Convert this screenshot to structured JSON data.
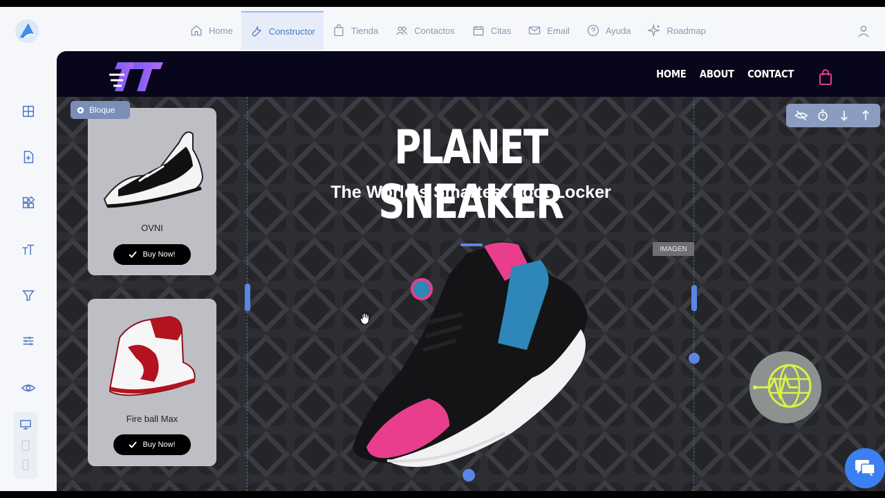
{
  "topnav": {
    "items": [
      {
        "label": "Home",
        "icon": "home-icon"
      },
      {
        "label": "Constructor",
        "icon": "wrench-icon",
        "active": true
      },
      {
        "label": "Tienda",
        "icon": "bag-icon"
      },
      {
        "label": "Contactos",
        "icon": "users-icon"
      },
      {
        "label": "Citas",
        "icon": "calendar-icon"
      },
      {
        "label": "Email",
        "icon": "mail-icon"
      },
      {
        "label": "Ayuda",
        "icon": "help-icon"
      },
      {
        "label": "Roadmap",
        "icon": "sparkle-icon"
      }
    ]
  },
  "sidebar": {
    "icons": [
      "layers-icon",
      "add-page-icon",
      "widgets-icon",
      "text-icon",
      "filter-icon",
      "sliders-icon",
      "eye-icon"
    ],
    "devices": [
      "desktop-icon",
      "tablet-icon",
      "mobile-icon"
    ]
  },
  "site": {
    "nav": [
      "HOME",
      "ABOUT",
      "CONTACT"
    ],
    "title": "PLANET SNEAKER",
    "subtitle": "The World's Smartest Foot Locker",
    "products": [
      {
        "name": "OVNI",
        "button": "Buy Now!"
      },
      {
        "name": "Fire ball Max",
        "button": "Buy Now!"
      }
    ]
  },
  "editor": {
    "block_label": "Bloque",
    "image_label": "IMAGEN"
  },
  "colors": {
    "accent": "#4f7bc4",
    "canvas_bg": "#2d2e33",
    "site_nav_bg": "#07061a",
    "pink": "#e83e8c",
    "teal": "#2f86b8"
  }
}
